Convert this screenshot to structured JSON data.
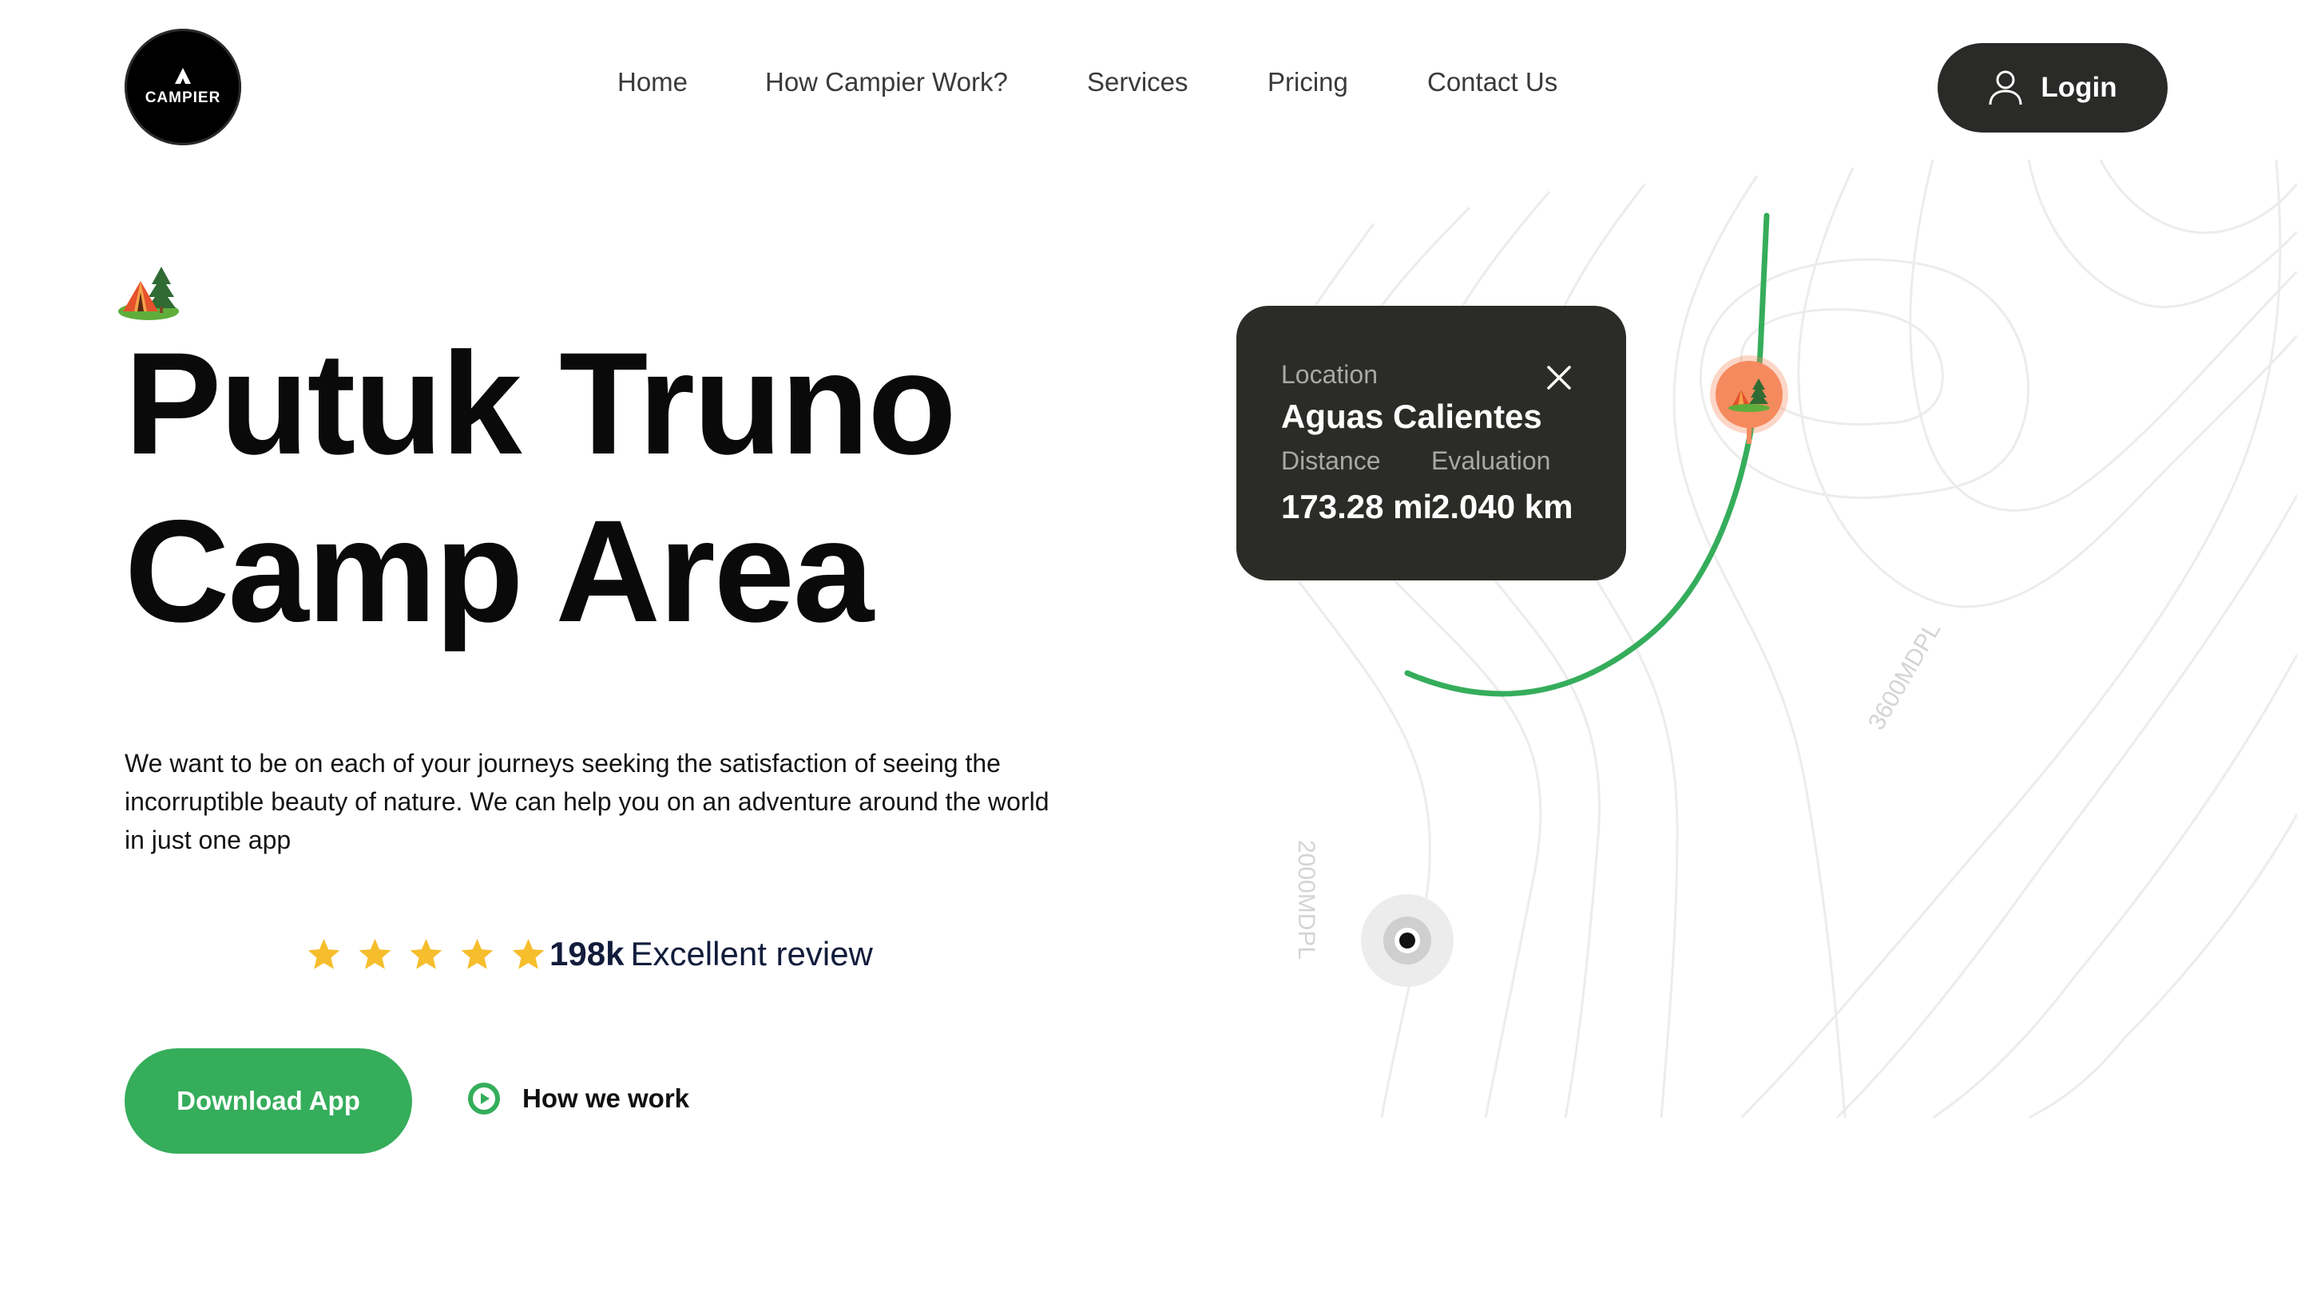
{
  "brand": {
    "name": "CAMPIER",
    "logo_icon": "tent-icon"
  },
  "nav": {
    "items": [
      {
        "label": "Home"
      },
      {
        "label": "How Campier Work?"
      },
      {
        "label": "Services"
      },
      {
        "label": "Pricing"
      },
      {
        "label": "Contact Us"
      }
    ]
  },
  "header": {
    "login_label": "Login",
    "login_icon": "user-icon"
  },
  "hero": {
    "emoji": "camping-tent-icon",
    "title_line1": "Putuk Truno",
    "title_line2": "Camp Area",
    "description": "We want to be on each of your journeys seeking the satisfaction of seeing the incorruptible beauty of nature. We can help you on an adventure around the world in just one app",
    "rating": {
      "stars": 5,
      "count": "198k",
      "label": "Excellent review"
    },
    "download_label": "Download App",
    "how_label": "How we work"
  },
  "map": {
    "popup": {
      "location_label": "Location",
      "location_name": "Aguas Calientes",
      "distance_label": "Distance",
      "evaluation_label": "Evaluation",
      "distance_value": "173.28 mi",
      "evaluation_value": "2.040 km"
    },
    "contour_labels": [
      "3600MDPL",
      "2000MDPL"
    ]
  },
  "colors": {
    "accent_green": "#35ad5b",
    "dark": "#2b2b28",
    "star_yellow": "#f6be2c",
    "pin_orange": "#f58a5e"
  }
}
